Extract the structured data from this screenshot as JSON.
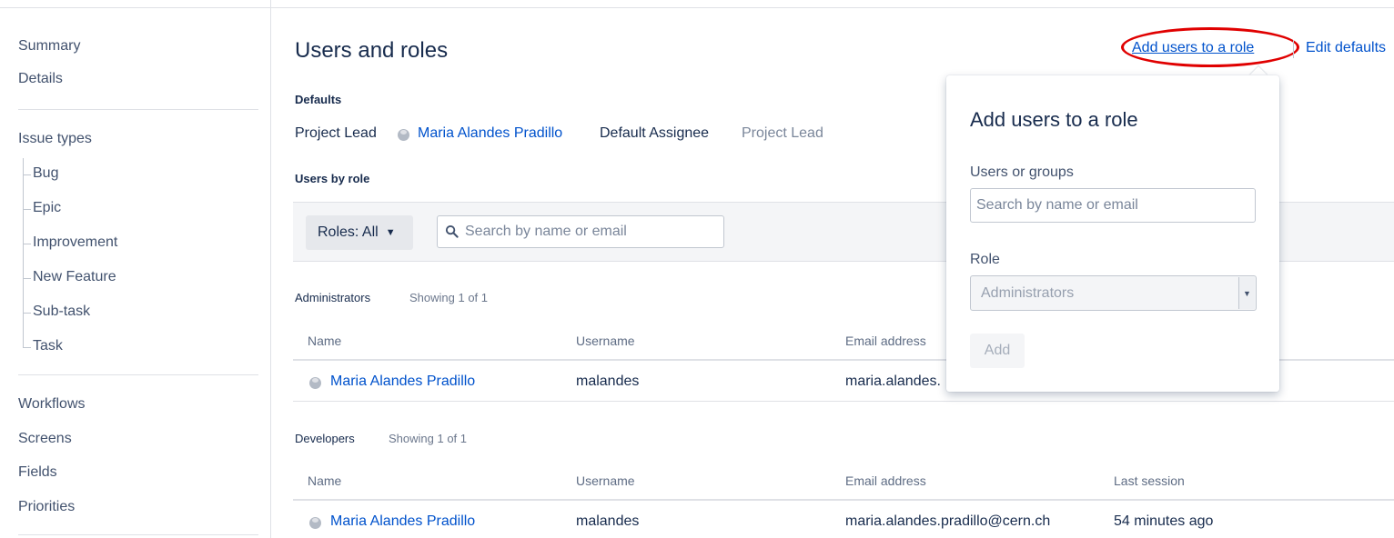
{
  "sidebar": {
    "top_items": [
      {
        "label": "Summary"
      },
      {
        "label": "Details"
      }
    ],
    "issue_types": {
      "label": "Issue types",
      "children": [
        "Bug",
        "Epic",
        "Improvement",
        "New Feature",
        "Sub-task",
        "Task"
      ]
    },
    "bottom_items": [
      {
        "label": "Workflows"
      },
      {
        "label": "Screens"
      },
      {
        "label": "Fields"
      },
      {
        "label": "Priorities"
      }
    ]
  },
  "main": {
    "title": "Users and roles",
    "header_links": {
      "add_users": "Add users to a role",
      "edit_defaults": "Edit defaults"
    },
    "defaults": {
      "heading": "Defaults",
      "project_lead_label": "Project Lead",
      "project_lead_value": "Maria Alandes Pradillo",
      "default_assignee_label": "Default Assignee",
      "default_assignee_value": "Project Lead"
    },
    "users_by_role_heading": "Users by role",
    "filter": {
      "roles_label": "Roles: All",
      "search_placeholder": "Search by name or email"
    },
    "sections": [
      {
        "role": "Administrators",
        "count": "Showing 1 of 1",
        "columns": [
          "Name",
          "Username",
          "Email address"
        ],
        "rows": [
          {
            "name": "Maria Alandes Pradillo",
            "username": "malandes",
            "email": "maria.alandes."
          }
        ]
      },
      {
        "role": "Developers",
        "count": "Showing 1 of 1",
        "columns": [
          "Name",
          "Username",
          "Email address",
          "Last session"
        ],
        "rows": [
          {
            "name": "Maria Alandes Pradillo",
            "username": "malandes",
            "email": "maria.alandes.pradillo@cern.ch",
            "last_session": "54 minutes ago"
          }
        ]
      }
    ]
  },
  "popover": {
    "title": "Add users to a role",
    "users_label": "Users or groups",
    "users_placeholder": "Search by name or email",
    "role_label": "Role",
    "role_value": "Administrators",
    "add_label": "Add"
  },
  "colors": {
    "link": "#0052cc",
    "highlight_annotation": "#e00000",
    "border": "#dfe1e6"
  },
  "icons": {
    "search": "search-icon",
    "dropdown": "caret-down-icon",
    "avatar": "avatar-icon"
  }
}
